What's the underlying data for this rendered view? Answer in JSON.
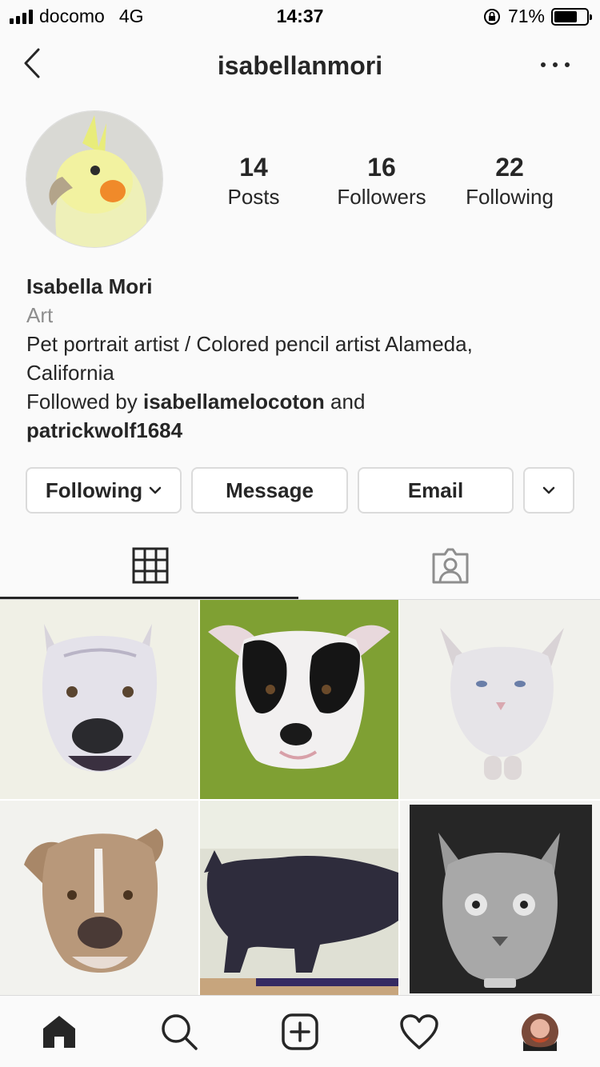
{
  "status_bar": {
    "carrier": "docomo",
    "network": "4G",
    "time": "14:37",
    "battery_percent_text": "71%",
    "battery_level": 0.71
  },
  "header": {
    "username": "isabellanmori"
  },
  "stats": {
    "posts": {
      "count": "14",
      "label": "Posts"
    },
    "followers": {
      "count": "16",
      "label": "Followers"
    },
    "following": {
      "count": "22",
      "label": "Following"
    }
  },
  "bio": {
    "name": "Isabella Mori",
    "category": "Art",
    "description_line1": "Pet portrait artist / Colored pencil artist Alameda,",
    "description_line2": "California",
    "followed_by_prefix": "Followed by ",
    "followed_by_user1": "isabellamelocoton",
    "followed_by_and": " and",
    "followed_by_user2": "patrickwolf1684"
  },
  "actions": {
    "following_label": "Following",
    "message_label": "Message",
    "email_label": "Email"
  },
  "tabs": {
    "grid": "grid-icon",
    "tagged": "tagged-person-icon",
    "active": "grid"
  },
  "posts": [
    {
      "icon": "pitbull-white-portrait"
    },
    {
      "icon": "black-white-dog-portrait"
    },
    {
      "icon": "white-cat-portrait"
    },
    {
      "icon": "brown-pitbull-portrait"
    },
    {
      "icon": "black-cat-drawing"
    },
    {
      "icon": "gray-cat-portrait"
    }
  ],
  "bottom_nav": [
    "home-icon",
    "search-icon",
    "new-post-icon",
    "activity-heart-icon",
    "profile-avatar"
  ],
  "colors": {
    "text": "#262626",
    "secondary": "#8e8e8e",
    "border": "#dbdbdb",
    "background": "#fafafa"
  }
}
